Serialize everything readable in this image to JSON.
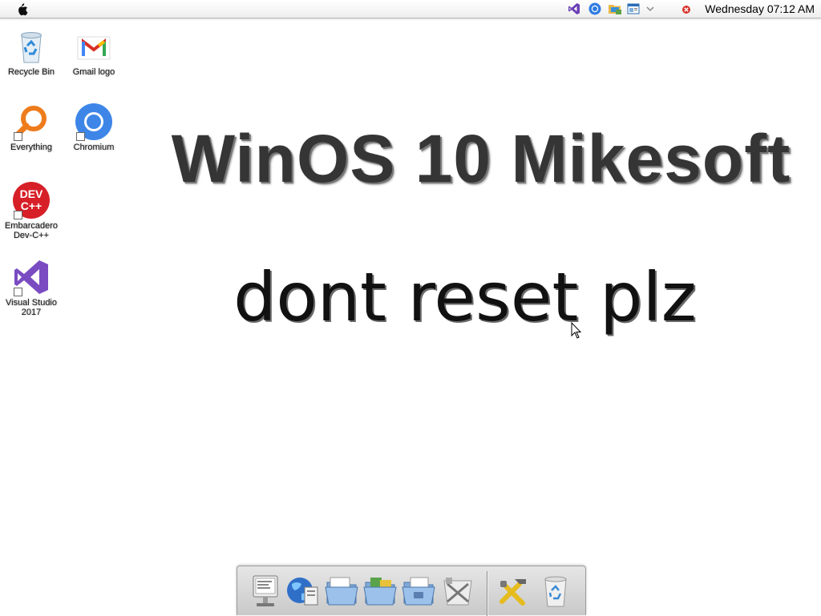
{
  "menubar": {
    "apple_menu_icon": "apple-icon",
    "tray_icons": [
      "visual-studio-icon",
      "chromium-icon",
      "folder-icon",
      "window-icon",
      "chevron-down-icon",
      "network-error-icon"
    ],
    "clock": "Wednesday 07:12 AM"
  },
  "desktop": {
    "icons": [
      {
        "label": "Recycle Bin",
        "icon": "recycle-bin-icon"
      },
      {
        "label": "Gmail logo",
        "icon": "gmail-icon"
      },
      {
        "label": "Everything",
        "icon": "search-magnifier-icon"
      },
      {
        "label": "Chromium",
        "icon": "chromium-icon"
      },
      {
        "label": "Embarcadero Dev-C++",
        "icon": "dev-cpp-icon"
      },
      {
        "label": "Visual Studio 2017",
        "icon": "visual-studio-icon"
      }
    ]
  },
  "wallpaper": {
    "title": "WinOS 10 Mikesoft",
    "subtitle": "dont reset plz"
  },
  "dock": {
    "items": [
      "finder-icon",
      "network-globe-icon",
      "folder-icon",
      "applications-folder-icon",
      "documents-folder-icon",
      "utilities-icon",
      "tools-icon",
      "trash-icon"
    ]
  },
  "colors": {
    "desktop_bg": "#ffffff",
    "menubar_bg": "#f4f4f4",
    "title_text": "#353535",
    "subtitle_text": "#111111",
    "dock_bg": "#d6d6d6"
  }
}
